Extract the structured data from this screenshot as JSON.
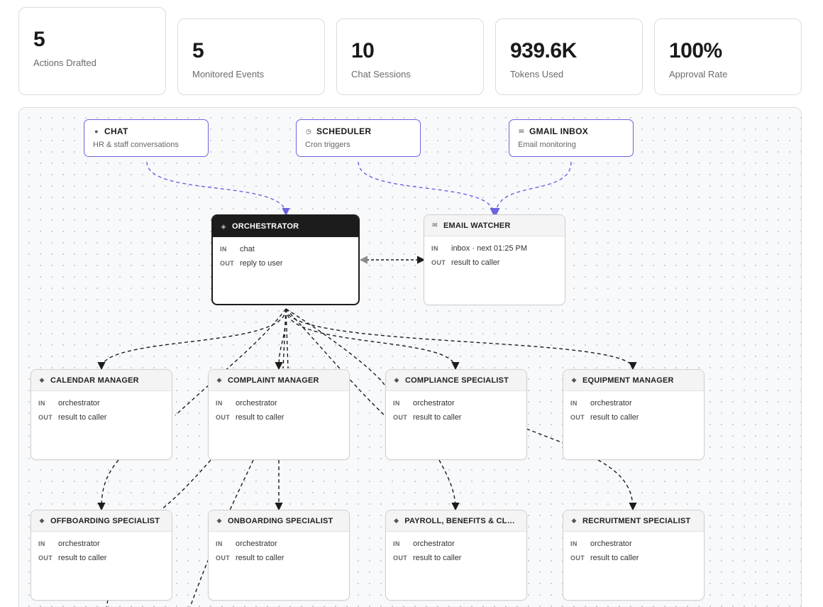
{
  "stats": [
    {
      "value": "5",
      "label": "Actions Drafted"
    },
    {
      "value": "5",
      "label": "Monitored Events"
    },
    {
      "value": "10",
      "label": "Chat Sessions"
    },
    {
      "value": "939.6K",
      "label": "Tokens Used"
    },
    {
      "value": "100%",
      "label": "Approval Rate"
    }
  ],
  "sources": {
    "chat": {
      "icon": "info-icon",
      "title": "CHAT",
      "subtitle": "HR & staff conversations"
    },
    "scheduler": {
      "icon": "clock-icon",
      "title": "SCHEDULER",
      "subtitle": "Cron triggers"
    },
    "gmail": {
      "icon": "mail-icon",
      "title": "GMAIL INBOX",
      "subtitle": "Email monitoring"
    }
  },
  "io_labels": {
    "in": "IN",
    "out": "OUT"
  },
  "orchestrator": {
    "icon": "diamond-icon",
    "title": "ORCHESTRATOR",
    "in": "chat",
    "out": "reply to user"
  },
  "email_watcher": {
    "icon": "mail-icon",
    "title": "EMAIL WATCHER",
    "in": "inbox · next 01:25 PM",
    "out": "result to caller"
  },
  "agents": [
    {
      "title": "CALENDAR MANAGER",
      "in": "orchestrator",
      "out": "result to caller"
    },
    {
      "title": "COMPLAINT MANAGER",
      "in": "orchestrator",
      "out": "result to caller"
    },
    {
      "title": "COMPLIANCE SPECIALIST",
      "in": "orchestrator",
      "out": "result to caller"
    },
    {
      "title": "EQUIPMENT MANAGER",
      "in": "orchestrator",
      "out": "result to caller"
    },
    {
      "title": "OFFBOARDING SPECIALIST",
      "in": "orchestrator",
      "out": "result to caller"
    },
    {
      "title": "ONBOARDING SPECIALIST",
      "in": "orchestrator",
      "out": "result to caller"
    },
    {
      "title": "PAYROLL, BENEFITS & CLAIM...",
      "in": "orchestrator",
      "out": "result to caller"
    },
    {
      "title": "RECRUITMENT SPECIALIST",
      "in": "orchestrator",
      "out": "result to caller"
    }
  ],
  "colors": {
    "accent": "#6c63e0",
    "edge": "#1c1c1c",
    "node_dark": "#1c1c1c"
  }
}
